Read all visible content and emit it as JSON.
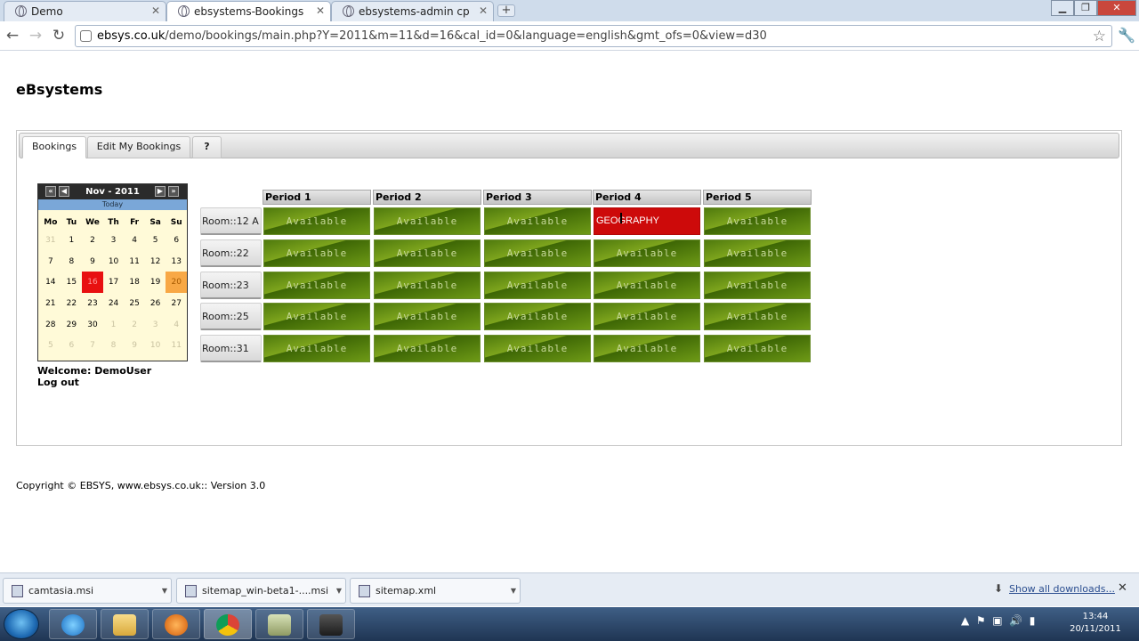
{
  "browser": {
    "tabs": [
      {
        "title": "Demo"
      },
      {
        "title": "ebsystems-Bookings"
      },
      {
        "title": "ebsystems-admin cp"
      }
    ],
    "url_host": "ebsys.co.uk",
    "url_path": "/demo/bookings/main.php?Y=2011&m=11&d=16&cal_id=0&language=english&gmt_ofs=0&view=d30"
  },
  "page": {
    "site_title": "eBsystems",
    "nav_tabs": [
      "Bookings",
      "Edit My Bookings",
      "?"
    ],
    "copyright": "Copyright © EBSYS, www.ebsys.co.uk:: Version 3.0"
  },
  "calendar": {
    "month_label": "Nov - 2011",
    "today_label": "Today",
    "weekdays": [
      "Mo",
      "Tu",
      "We",
      "Th",
      "Fr",
      "Sa",
      "Su"
    ],
    "weeks": [
      [
        "31",
        "1",
        "2",
        "3",
        "4",
        "5",
        "6"
      ],
      [
        "7",
        "8",
        "9",
        "10",
        "11",
        "12",
        "13"
      ],
      [
        "14",
        "15",
        "16",
        "17",
        "18",
        "19",
        "20"
      ],
      [
        "21",
        "22",
        "23",
        "24",
        "25",
        "26",
        "27"
      ],
      [
        "28",
        "29",
        "30",
        "1",
        "2",
        "3",
        "4"
      ],
      [
        "5",
        "6",
        "7",
        "8",
        "9",
        "10",
        "11"
      ]
    ],
    "selected_day": "16",
    "highlight_day": "20",
    "colors": {
      "selected": "#e81010",
      "highlight": "#f8a845"
    }
  },
  "user": {
    "welcome": "Welcome: DemoUser",
    "logout": "Log out"
  },
  "bookings": {
    "periods": [
      "Period 1",
      "Period 2",
      "Period 3",
      "Period 4",
      "Period 5"
    ],
    "available_label": "Available",
    "rooms": [
      {
        "name": "Room::12 A",
        "slots": [
          "Available",
          "Available",
          "Available",
          "GEOGRAPHY",
          "Available"
        ]
      },
      {
        "name": "Room::22",
        "slots": [
          "Available",
          "Available",
          "Available",
          "Available",
          "Available"
        ]
      },
      {
        "name": "Room::23",
        "slots": [
          "Available",
          "Available",
          "Available",
          "Available",
          "Available"
        ]
      },
      {
        "name": "Room::25",
        "slots": [
          "Available",
          "Available",
          "Available",
          "Available",
          "Available"
        ]
      },
      {
        "name": "Room::31",
        "slots": [
          "Available",
          "Available",
          "Available",
          "Available",
          "Available"
        ]
      }
    ],
    "colors": {
      "booked": "#cd0a0a",
      "available": "#5d8a12"
    }
  },
  "downloads": {
    "items": [
      "camtasia.msi",
      "sitemap_win-beta1-....msi",
      "sitemap.xml"
    ],
    "show_all": "Show all downloads..."
  },
  "taskbar": {
    "time": "13:44",
    "date": "20/11/2011"
  }
}
